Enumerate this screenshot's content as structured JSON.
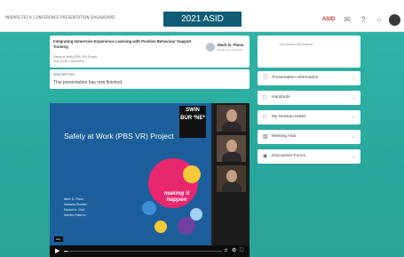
{
  "header": {
    "app_title": "INSPIRE-TECH CONFERENCE PRESENTATION DASHBOARD",
    "conference_title": "2021 ASID Conference",
    "logo_text": "ASID"
  },
  "session": {
    "title": "Integrating Immersive Experience Learning with Positive Behaviour Support Training",
    "meta_line1": "Safety at Work (PBS VR) Project",
    "meta_line2": "2021 ASID Conference",
    "speaker_name": "Mark D. Plane",
    "speaker_role": "Swinburne University"
  },
  "description": {
    "heading": "DESCRIPTION",
    "text": "This presentation has now finished."
  },
  "notice": {
    "text": "This session has finished"
  },
  "panels": [
    {
      "label": "Presentation Information",
      "icon": "info-icon"
    },
    {
      "label": "Handouts",
      "icon": "document-icon"
    },
    {
      "label": "My Session Notes",
      "icon": "notes-icon"
    },
    {
      "label": "Meeting Hub",
      "icon": "meeting-icon"
    },
    {
      "label": "Discussion Forum",
      "icon": "chat-icon"
    }
  ],
  "video": {
    "slide_title": "Safety at Work (PBS VR) Project",
    "slide_authors": [
      "Mark D. Plane",
      "Natasha Stockel",
      "Rachel A. Gold",
      "Sandra Paterno"
    ],
    "logo_text": "SWIN BUR *NE*",
    "tagline": "making it happen",
    "tooltip": "Play",
    "progress": 0.02
  },
  "colors": {
    "teal_bg": "#2fb3a7",
    "title_bar": "#0f5d74",
    "slide_blue": "#1c5f9c",
    "circle_pink": "#e8276f",
    "circle_yellow": "#f4c93a",
    "circle_blue": "#3d8fd6",
    "circle_purple": "#6f3fa1",
    "circle_light_blue": "#a2d2f0"
  }
}
